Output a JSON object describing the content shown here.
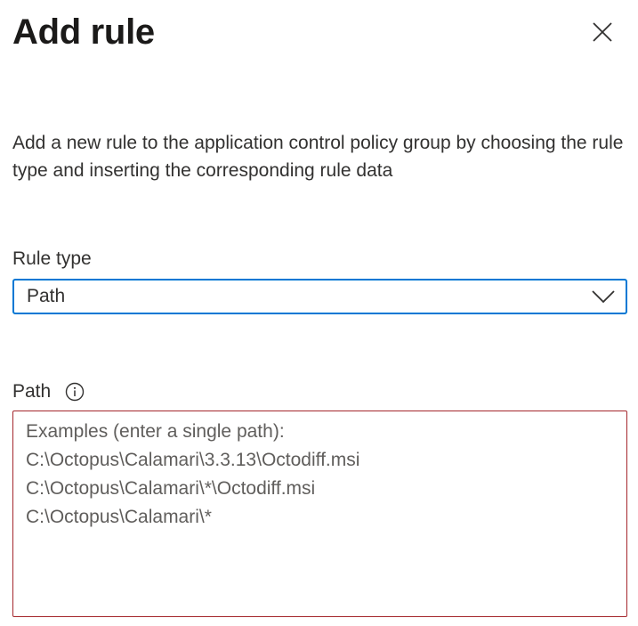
{
  "panel": {
    "title": "Add rule",
    "close_icon": "close-icon",
    "description": "Add a new rule to the application control policy group by choosing the rule type and inserting the corresponding rule data"
  },
  "rule_type": {
    "label": "Rule type",
    "selected_value": "Path",
    "chevron_icon": "chevron-down-icon"
  },
  "path": {
    "label": "Path",
    "info_icon": "info-icon",
    "value": "",
    "placeholder_lines": [
      "Examples (enter a single path):",
      "C:\\Octopus\\Calamari\\3.3.13\\Octodiff.msi",
      "C:\\Octopus\\Calamari\\*\\Octodiff.msi",
      "C:\\Octopus\\Calamari\\*"
    ]
  },
  "colors": {
    "focus_border": "#0078d4",
    "error_border": "#a4262c",
    "text": "#323130",
    "placeholder": "#605e5c"
  }
}
